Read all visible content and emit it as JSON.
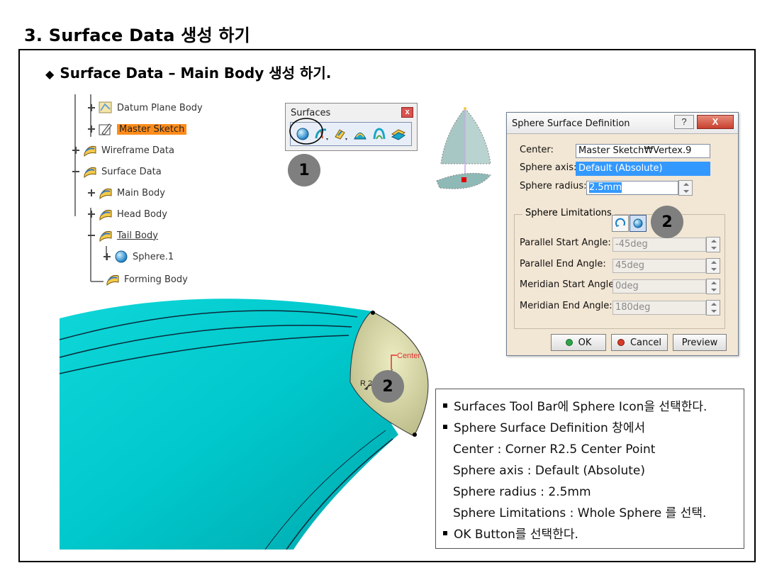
{
  "slide": {
    "title": "3. Surface Data 생성 하기",
    "subtitle": "Surface Data – Main Body 생성 하기.",
    "subtitle_bullet": "◆"
  },
  "tree": {
    "items": [
      {
        "label": "Datum Plane Body",
        "icon": "plane-body-icon"
      },
      {
        "label": "Master Sketch",
        "icon": "sketch-icon",
        "highlighted": true
      },
      {
        "label": "Wireframe Data",
        "icon": "geometric-set-icon"
      },
      {
        "label": "Surface Data",
        "icon": "geometric-set-icon"
      },
      {
        "label": "Main Body",
        "icon": "geometric-set-icon"
      },
      {
        "label": "Head Body",
        "icon": "geometric-set-icon"
      },
      {
        "label": "Tail Body",
        "icon": "geometric-set-icon",
        "underlined": true
      },
      {
        "label": "Sphere.1",
        "icon": "sphere-icon"
      },
      {
        "label": "Forming Body",
        "icon": "geometric-set-icon"
      }
    ]
  },
  "toolbar": {
    "title": "Surfaces",
    "close": "x",
    "buttons": [
      "sphere-icon",
      "revolve-icon",
      "offset-icon",
      "sweep-icon",
      "fill-icon",
      "blend-icon"
    ]
  },
  "callouts": {
    "one": "1",
    "two": "2"
  },
  "dialog": {
    "title": "Sphere Surface Definition",
    "help": "?",
    "close": "X",
    "center_label": "Center:",
    "center_value": "Master Sketch₩Vertex.9",
    "axis_label": "Sphere axis:",
    "axis_value": "Default (Absolute)",
    "radius_label": "Sphere radius:",
    "radius_value": "2.5mm",
    "group_title": "Sphere Limitations",
    "parallel_start_label": "Parallel Start Angle:",
    "parallel_start_value": "-45deg",
    "parallel_end_label": "Parallel End Angle:",
    "parallel_end_value": "45deg",
    "meridian_start_label": "Meridian Start Angle:",
    "meridian_start_value": "0deg",
    "meridian_end_label": "Meridian End Angle:",
    "meridian_end_value": "180deg",
    "ok": "OK",
    "cancel": "Cancel",
    "preview": "Preview"
  },
  "model": {
    "center_label": "Center",
    "radius_label": "R 2.5"
  },
  "notes": [
    {
      "text": "Surfaces Tool Bar에 Sphere Icon을 선택한다.",
      "bullet": true
    },
    {
      "text": "Sphere Surface Definition 창에서",
      "bullet": true
    },
    {
      "text": "Center : Corner R2.5 Center Point",
      "bullet": false
    },
    {
      "text": "Sphere axis : Default (Absolute)",
      "bullet": false
    },
    {
      "text": "Sphere radius : 2.5mm",
      "bullet": false
    },
    {
      "text": "Sphere Limitations : Whole Sphere 를 선택.",
      "bullet": false
    },
    {
      "text": "OK Button를 선택한다.",
      "bullet": true
    }
  ],
  "colors": {
    "surface": "#00c8cc",
    "sphere": "#d8d8a0",
    "highlight": "#ff8c1a",
    "callout": "#7f7f7f",
    "dialog_bg": "#f2e6d4",
    "selection": "#3399ff"
  }
}
